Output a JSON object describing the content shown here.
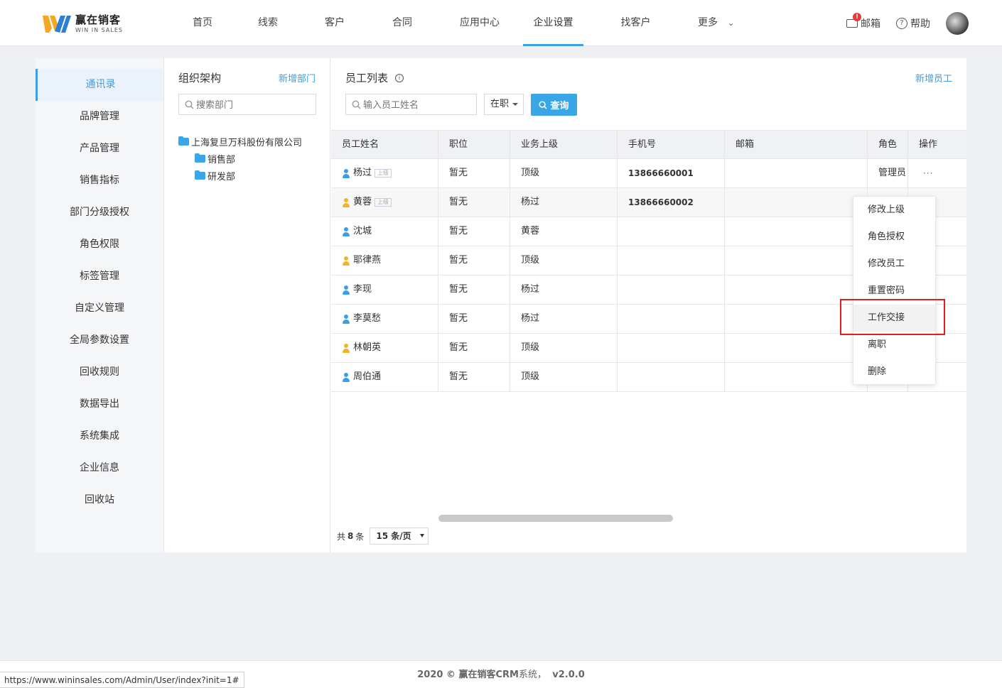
{
  "app": {
    "logo_cn": "赢在销客",
    "logo_en": "WIN IN SALES",
    "brand_color": "#3c9fe6"
  },
  "nav": {
    "items": [
      {
        "label": "首页"
      },
      {
        "label": "线索"
      },
      {
        "label": "客户"
      },
      {
        "label": "合同"
      },
      {
        "label": "应用中心"
      },
      {
        "label": "企业设置",
        "active": true
      },
      {
        "label": "找客户"
      },
      {
        "label": "更多"
      }
    ],
    "mail_label": "邮箱",
    "mail_badge": "!",
    "help_label": "帮助",
    "help_icon": "?"
  },
  "sidebar": {
    "items": [
      {
        "label": "通讯录"
      },
      {
        "label": "品牌管理"
      },
      {
        "label": "产品管理"
      },
      {
        "label": "销售指标"
      },
      {
        "label": "部门分级授权"
      },
      {
        "label": "角色权限"
      },
      {
        "label": "标签管理"
      },
      {
        "label": "自定义管理"
      },
      {
        "label": "全局参数设置"
      },
      {
        "label": "回收规则"
      },
      {
        "label": "数据导出"
      },
      {
        "label": "系统集成"
      },
      {
        "label": "企业信息"
      },
      {
        "label": "回收站"
      }
    ]
  },
  "org": {
    "title": "组织架构",
    "add_label": "新增部门",
    "search_placeholder": "搜索部门",
    "root": "上海复旦万科股份有限公司",
    "children": [
      "销售部",
      "研发部"
    ]
  },
  "employees": {
    "title": "员工列表",
    "info_icon": "i",
    "add_label": "新增员工",
    "search_placeholder": "输入员工姓名",
    "status_value": "在职",
    "query_label": "查询",
    "columns": [
      "员工姓名",
      "职位",
      "业务上级",
      "手机号",
      "邮箱",
      "角色",
      "操作"
    ],
    "superior_tag": "上级",
    "action_dots": "···",
    "rows": [
      {
        "name": "杨过",
        "tag": true,
        "position": "暂无",
        "superior": "顶级",
        "phone": "13866660001",
        "email": "",
        "role": "管理员",
        "color": "#3c9fe6"
      },
      {
        "name": "黄蓉",
        "tag": true,
        "position": "暂无",
        "superior": "杨过",
        "phone": "13866660002",
        "email": "",
        "role": "",
        "color": "#f0b429"
      },
      {
        "name": "沈城",
        "tag": false,
        "position": "暂无",
        "superior": "黄蓉",
        "phone": "",
        "email": "",
        "role": "",
        "color": "#3c9fe6"
      },
      {
        "name": "耶律燕",
        "tag": false,
        "position": "暂无",
        "superior": "顶级",
        "phone": "",
        "email": "",
        "role": "",
        "color": "#f0b429"
      },
      {
        "name": "李现",
        "tag": false,
        "position": "暂无",
        "superior": "杨过",
        "phone": "",
        "email": "",
        "role": "",
        "color": "#3c9fe6"
      },
      {
        "name": "李莫愁",
        "tag": false,
        "position": "暂无",
        "superior": "杨过",
        "phone": "",
        "email": "",
        "role": "",
        "color": "#3c9fe6"
      },
      {
        "name": "林朝英",
        "tag": false,
        "position": "暂无",
        "superior": "顶级",
        "phone": "",
        "email": "",
        "role": "",
        "color": "#f0b429"
      },
      {
        "name": "周伯通",
        "tag": false,
        "position": "暂无",
        "superior": "顶级",
        "phone": "",
        "email": "",
        "role": "",
        "color": "#3c9fe6"
      }
    ],
    "total_prefix": "共",
    "total_count": "8",
    "total_suffix": "条",
    "page_size": "15 条/页"
  },
  "action_menu": {
    "items": [
      "修改上级",
      "角色授权",
      "修改员工",
      "重置密码",
      "工作交接",
      "离职",
      "删除"
    ]
  },
  "footer": {
    "text_prefix": "2020 © 赢在销客",
    "text_crm": "CRM",
    "text_system": "系统，",
    "version": "v2.0.0"
  },
  "status_url": "https://www.wininsales.com/Admin/User/index?init=1#"
}
